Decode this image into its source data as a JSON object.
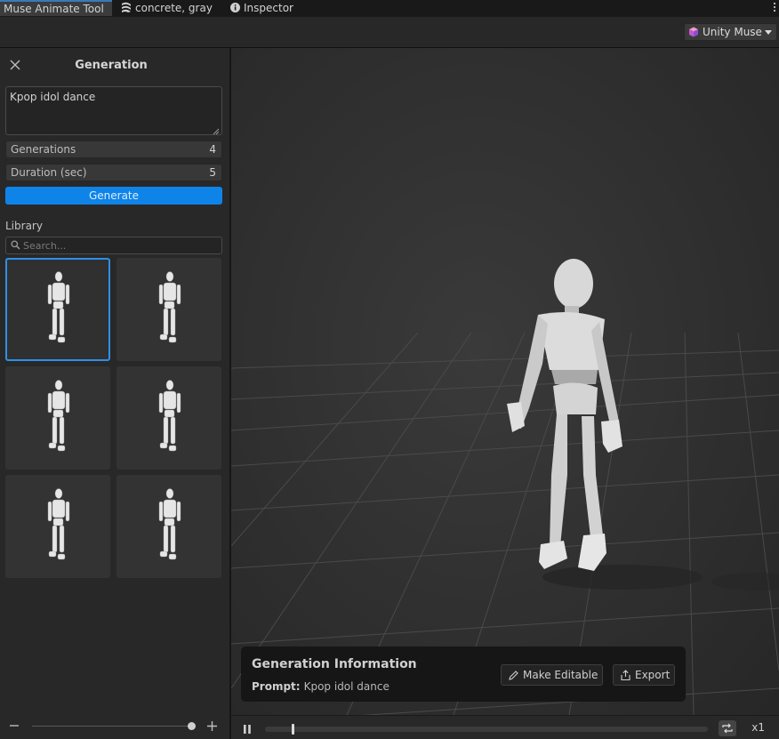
{
  "tabs": [
    {
      "label": "Muse Animate Tool",
      "active": true,
      "icon": ""
    },
    {
      "label": "concrete, gray",
      "active": false,
      "icon": "material-icon"
    },
    {
      "label": "Inspector",
      "active": false,
      "icon": "info-icon"
    }
  ],
  "toolbar": {
    "muse_label": "Unity Muse"
  },
  "generation": {
    "title": "Generation",
    "prompt": "Kpop idol dance",
    "generations_label": "Generations",
    "generations_value": "4",
    "duration_label": "Duration (sec)",
    "duration_value": "5",
    "generate_label": "Generate"
  },
  "library": {
    "label": "Library",
    "search_placeholder": "Search...",
    "items": [
      {
        "selected": true
      },
      {
        "selected": false
      },
      {
        "selected": false
      },
      {
        "selected": false
      },
      {
        "selected": false
      },
      {
        "selected": false
      }
    ],
    "zoom": 1.0
  },
  "info": {
    "title": "Generation Information",
    "prompt_label": "Prompt:",
    "prompt_value": "Kpop idol dance",
    "make_editable_label": "Make Editable",
    "export_label": "Export"
  },
  "timeline": {
    "progress": 0.06,
    "speed_label": "x1"
  },
  "colors": {
    "accent": "#0f84e8",
    "selection": "#2f8fe6",
    "panel": "#282828",
    "viewport": "#323232"
  }
}
